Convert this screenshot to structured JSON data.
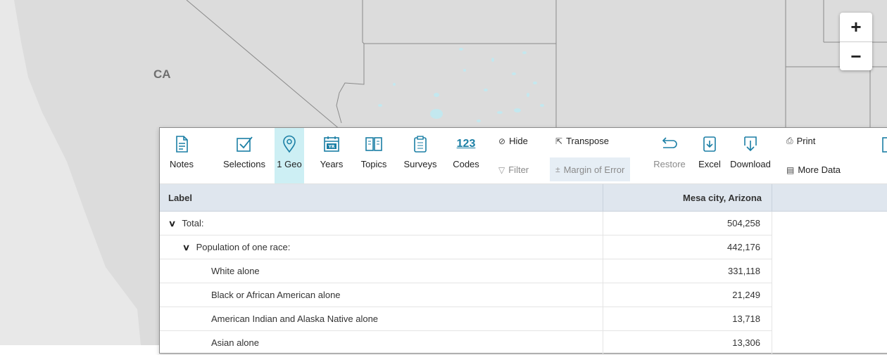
{
  "map": {
    "state_label": "CA",
    "zoom_in_label": "+",
    "zoom_out_label": "−",
    "colors": {
      "land": "#dcdcdc",
      "ocean": "#e8e8e8",
      "water": "#c3e8ef",
      "border": "#8a8a8a"
    }
  },
  "toolbar": {
    "notes": "Notes",
    "selections": "Selections",
    "geo": "1 Geo",
    "years": "Years",
    "topics": "Topics",
    "surveys": "Surveys",
    "codes": "Codes",
    "codes_glyph": "123",
    "years_glyph": "YR",
    "hide": "Hide",
    "filter": "Filter",
    "transpose": "Transpose",
    "margin_of_error": "Margin of Error",
    "restore": "Restore",
    "excel": "Excel",
    "download": "Download",
    "print": "Print",
    "more_data": "More Data",
    "accent_color": "#1b7fa5",
    "active_color": "#cdeff4"
  },
  "table": {
    "headers": {
      "label": "Label",
      "value": "Mesa city, Arizona"
    },
    "rows": [
      {
        "label": "Total:",
        "value": "504,258"
      },
      {
        "label": "Population of one race:",
        "value": "442,176"
      },
      {
        "label": "White alone",
        "value": "331,118"
      },
      {
        "label": "Black or African American alone",
        "value": "21,249"
      },
      {
        "label": "American Indian and Alaska Native alone",
        "value": "13,718"
      },
      {
        "label": "Asian alone",
        "value": "13,306"
      }
    ]
  }
}
